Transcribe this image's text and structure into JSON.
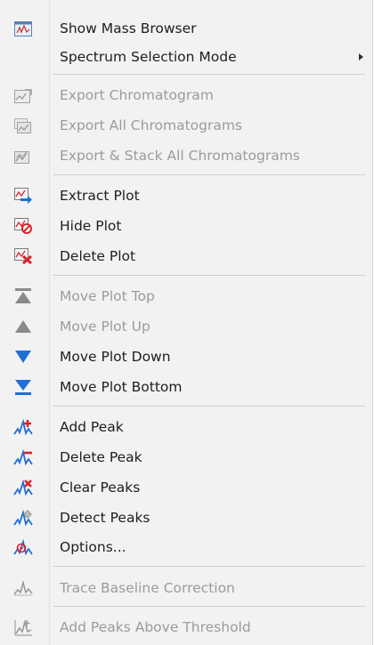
{
  "menu": {
    "items": [
      {
        "label": "Show Mass Browser",
        "icon": "mass-browser-icon",
        "enabled": true
      },
      {
        "label": "Spectrum Selection Mode",
        "icon": "",
        "enabled": true,
        "submenu": true
      },
      {
        "label": "Export Chromatogram",
        "icon": "export-chromatogram-icon",
        "enabled": false
      },
      {
        "label": "Export All Chromatograms",
        "icon": "export-all-chromatograms-icon",
        "enabled": false
      },
      {
        "label": "Export & Stack All Chromatograms",
        "icon": "export-stack-chromatograms-icon",
        "enabled": false
      },
      {
        "label": "Extract Plot",
        "icon": "extract-plot-icon",
        "enabled": true
      },
      {
        "label": "Hide Plot",
        "icon": "hide-plot-icon",
        "enabled": true
      },
      {
        "label": "Delete Plot",
        "icon": "delete-plot-icon",
        "enabled": true
      },
      {
        "label": "Move Plot Top",
        "icon": "move-top-icon",
        "enabled": false
      },
      {
        "label": "Move Plot Up",
        "icon": "move-up-icon",
        "enabled": false
      },
      {
        "label": "Move Plot Down",
        "icon": "move-down-icon",
        "enabled": true
      },
      {
        "label": "Move Plot Bottom",
        "icon": "move-bottom-icon",
        "enabled": true
      },
      {
        "label": "Add Peak",
        "icon": "add-peak-icon",
        "enabled": true
      },
      {
        "label": "Delete Peak",
        "icon": "delete-peak-icon",
        "enabled": true
      },
      {
        "label": "Clear Peaks",
        "icon": "clear-peaks-icon",
        "enabled": true
      },
      {
        "label": "Detect Peaks",
        "icon": "detect-peaks-icon",
        "enabled": true
      },
      {
        "label": "Options...",
        "icon": "options-icon",
        "enabled": true
      },
      {
        "label": "Trace Baseline Correction",
        "icon": "baseline-correction-icon",
        "enabled": false
      },
      {
        "label": "Add Peaks Above Threshold",
        "icon": "threshold-peaks-icon",
        "enabled": false
      }
    ]
  },
  "colors": {
    "text": "#1e1e1e",
    "disabled_text": "#9b9b9b",
    "menu_bg": "#f2f2f2",
    "icon_blue": "#1f6fd6",
    "icon_red": "#d8232a",
    "icon_gray": "#8a8a8a"
  }
}
